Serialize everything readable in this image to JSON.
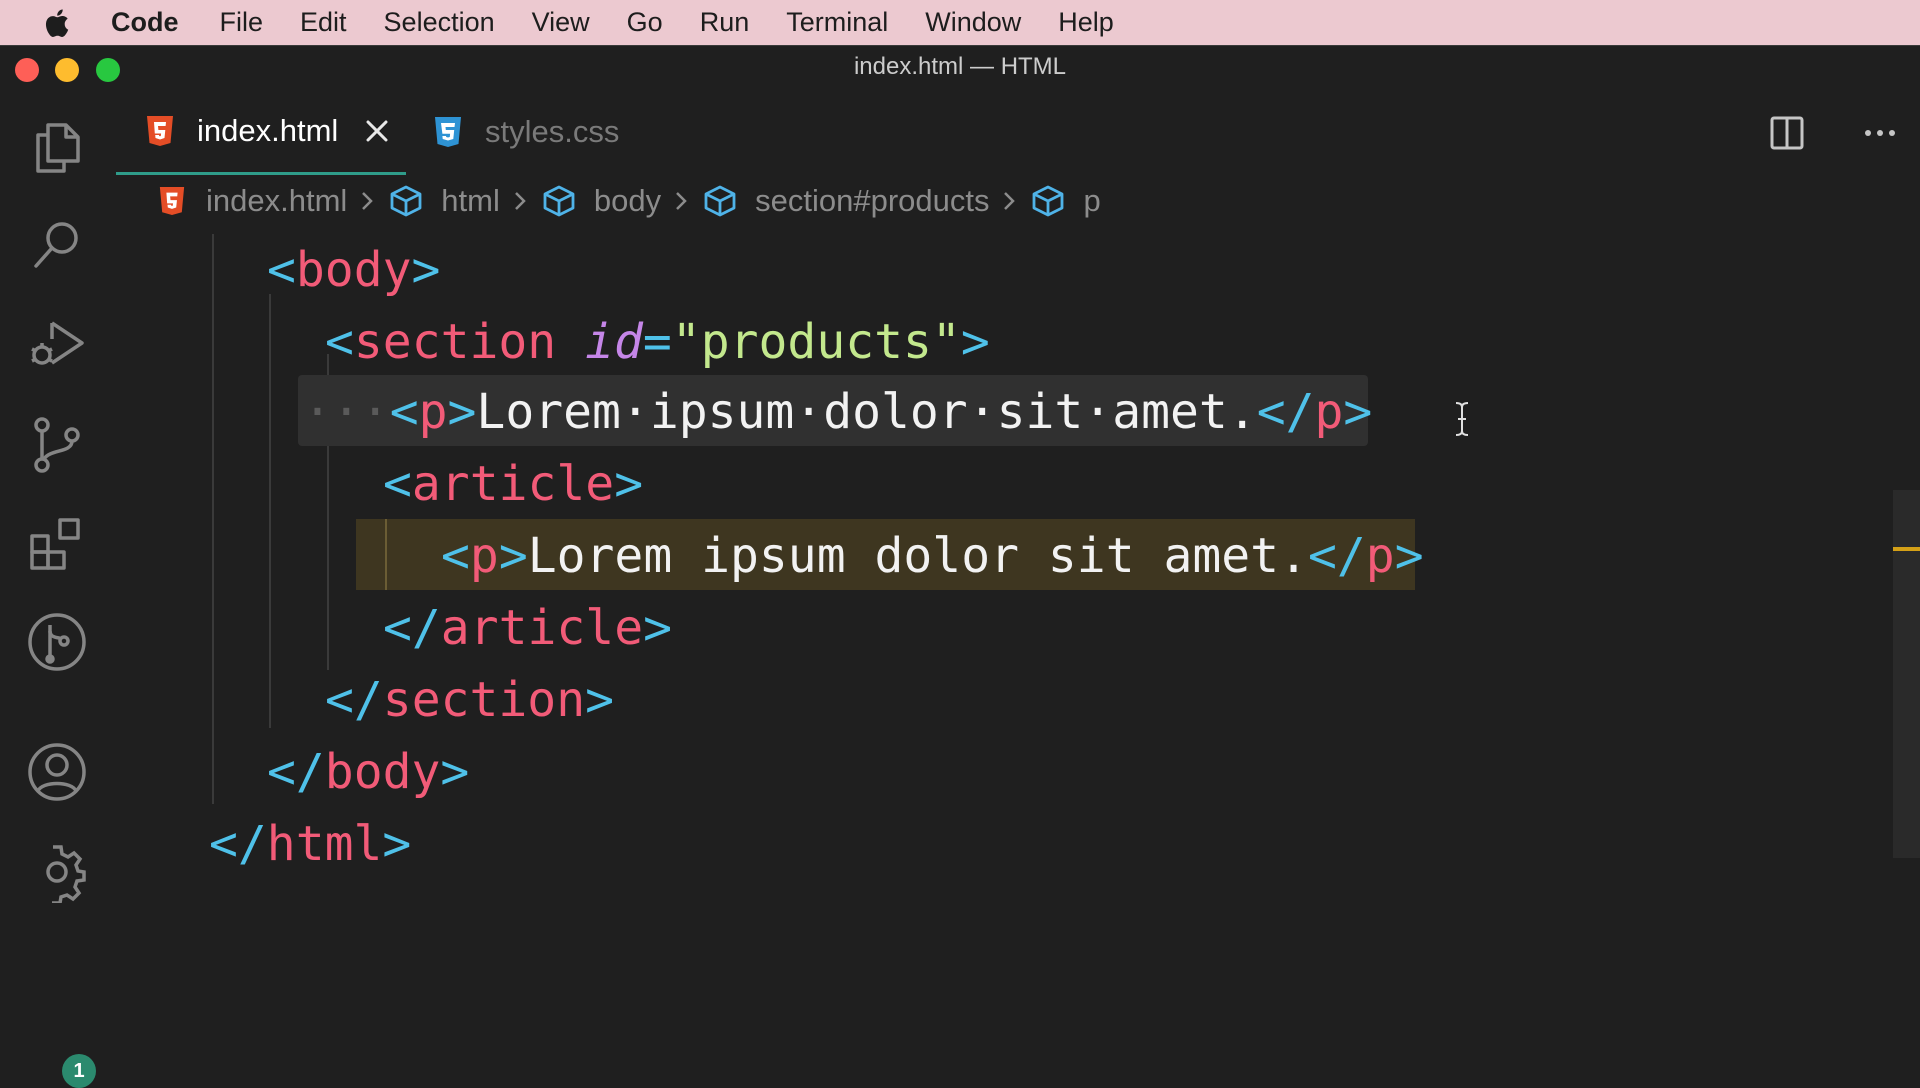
{
  "menubar": {
    "app_name": "Code",
    "items": [
      "File",
      "Edit",
      "Selection",
      "View",
      "Go",
      "Run",
      "Terminal",
      "Window",
      "Help"
    ]
  },
  "window": {
    "title": "index.html — HTML"
  },
  "activity_bar": {
    "icons": [
      "explorer-icon",
      "search-icon",
      "run-debug-icon",
      "source-control-icon",
      "extensions-icon",
      "git-graph-icon",
      "account-icon",
      "settings-gear-icon"
    ],
    "settings_badge": "1"
  },
  "tabs": [
    {
      "label": "index.html",
      "icon": "html5-file-icon",
      "active": true
    },
    {
      "label": "styles.css",
      "icon": "css3-file-icon",
      "active": false
    }
  ],
  "breadcrumbs": [
    "index.html",
    "html",
    "body",
    "section#products",
    "p"
  ],
  "editor": {
    "lines": {
      "l1": {
        "open": "<",
        "tag": "body",
        "close": ">"
      },
      "l2": {
        "open": "<",
        "tag": "section",
        "attr": "id",
        "eq": "=",
        "q1": "\"",
        "value": "products",
        "q2": "\"",
        "close": ">"
      },
      "l3": {
        "ws": "···",
        "open": "<",
        "tag": "p",
        "gt": ">",
        "text": "Lorem·ipsum·dolor·sit·amet.",
        "copen": "</",
        "ctag": "p",
        "cclose": ">"
      },
      "l4": {
        "open": "<",
        "tag": "article",
        "close": ">"
      },
      "l5": {
        "open": "<",
        "tag": "p",
        "gt": ">",
        "text": "Lorem ipsum dolor sit amet.",
        "copen": "</",
        "ctag": "p",
        "cclose": ">"
      },
      "l6": {
        "open": "</",
        "tag": "article",
        "close": ">"
      },
      "l7": {
        "open": "</",
        "tag": "section",
        "close": ">"
      },
      "l8": {
        "open": "</",
        "tag": "body",
        "close": ">"
      },
      "l9": {
        "open": "</",
        "tag": "html",
        "close": ">"
      }
    }
  },
  "colors": {
    "menubar_bg": "#ecc9d0",
    "editor_bg": "#1f1f1f",
    "active_tab_border": "#2f9c8a",
    "tag_punctuation": "#4fc1e9",
    "tag_name": "#f25b78",
    "attribute": "#c586e8",
    "string": "#c3e88d",
    "text": "#f2f2f2",
    "current_line_highlight": "#3e3620",
    "overview_marker": "#d4a017"
  }
}
